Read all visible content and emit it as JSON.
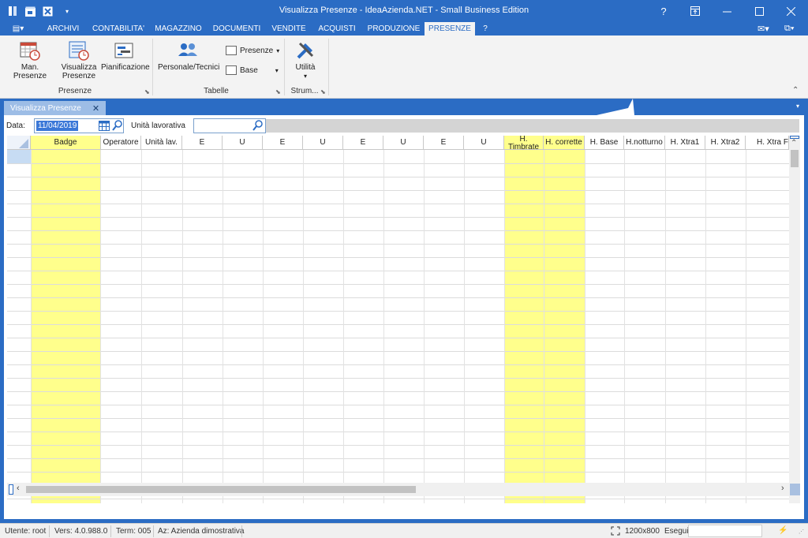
{
  "window": {
    "title": "Visualizza Presenze - IdeaAzienda.NET - Small Business Edition",
    "help": "?",
    "controls": {
      "restore_icon": "ribbon-display-icon",
      "minimize": "—",
      "maximize": "☐",
      "close": "✕"
    }
  },
  "menu": {
    "app_button": "▤▾",
    "tabs": [
      "ARCHIVI",
      "CONTABILITA'",
      "MAGAZZINO",
      "DOCUMENTI",
      "VENDITE",
      "ACQUISTI",
      "PRODUZIONE",
      "PRESENZE",
      "?"
    ],
    "active_tab": "PRESENZE",
    "mail": "✉▾",
    "windows": "⧉▾"
  },
  "ribbon": {
    "groups": [
      {
        "label": "Presenze",
        "buttons": [
          "Man. Presenze",
          "Visualizza\nPresenze",
          "Pianificazione"
        ]
      },
      {
        "label": "Tabelle",
        "buttons": [
          "Personale/Tecnici"
        ],
        "small_buttons": [
          "Presenze",
          "Base"
        ]
      },
      {
        "label": "Strum...",
        "buttons": [
          "Utilità"
        ]
      }
    ],
    "collapse": "⌃"
  },
  "document_tab": {
    "label": "Visualizza Presenze",
    "close": "✕"
  },
  "filters": {
    "date_label": "Data:",
    "date_value": "11/04/2019",
    "unit_label": "Unità lavorativa",
    "unit_value": ""
  },
  "grid": {
    "columns": [
      "Badge",
      "Operatore",
      "Unità lav.",
      "E",
      "U",
      "E",
      "U",
      "E",
      "U",
      "E",
      "U",
      "H. Timbrate",
      "H. corrette",
      "H. Base",
      "H.notturno",
      "H. Xtra1",
      "H. Xtra2",
      "H. Xtra Fe"
    ],
    "highlighted_columns": [
      "Badge",
      "H. Timbrate"
    ],
    "rows": []
  },
  "status": {
    "user": "Utente: root",
    "version": "Vers: 4.0.988.0",
    "terminal": "Term: 005",
    "company": "Az: Azienda dimostrativa",
    "resolution": "1200x800",
    "execute": "Esegui",
    "lightning": "⚡"
  },
  "colors": {
    "accent": "#2b6cc4",
    "highlight_column": "#ffff8c",
    "selection": "#3b78d8"
  }
}
